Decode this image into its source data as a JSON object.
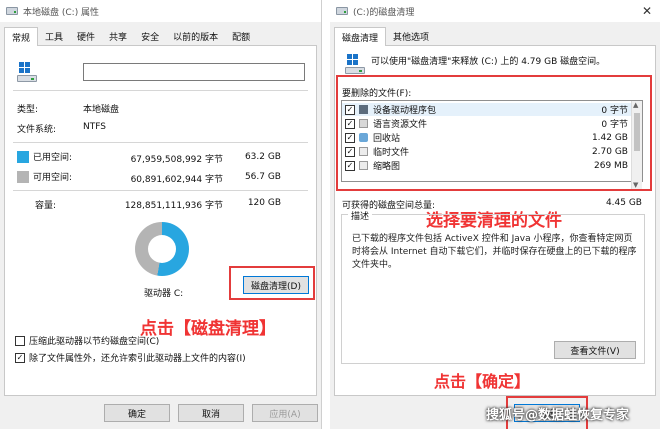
{
  "left": {
    "title": "本地磁盘 (C:) 属性",
    "close_glyph": "✕",
    "tabs": [
      "常规",
      "工具",
      "硬件",
      "共享",
      "安全",
      "以前的版本",
      "配额"
    ],
    "type_label": "类型:",
    "type_value": "本地磁盘",
    "fs_label": "文件系统:",
    "fs_value": "NTFS",
    "used_label": "已用空间:",
    "used_bytes": "67,959,508,992 字节",
    "used_gb": "63.2 GB",
    "free_label": "可用空间:",
    "free_bytes": "60,891,602,944 字节",
    "free_gb": "56.7 GB",
    "cap_label": "容量:",
    "cap_bytes": "128,851,111,936 字节",
    "cap_gb": "120 GB",
    "used_fraction": 0.527,
    "drive_label": "驱动器 C:",
    "cleanup_btn": "磁盘清理(D)",
    "compress_label": "压缩此驱动器以节约磁盘空间(C)",
    "compress_checked": false,
    "index_label": "除了文件属性外，还允许索引此驱动器上文件的内容(I)",
    "index_checked": true,
    "ok_btn": "确定",
    "cancel_btn": "取消",
    "apply_btn": "应用(A)",
    "annotation": "点击【磁盘清理】"
  },
  "right": {
    "title": "(C:)的磁盘清理",
    "close_glyph": "✕",
    "tabs": [
      "磁盘清理",
      "其他选项"
    ],
    "intro": "可以使用\"磁盘清理\"来释放 (C:) 上的 4.79 GB 磁盘空间。",
    "files_label": "要删除的文件(F):",
    "files": [
      {
        "name": "设备驱动程序包",
        "size": "0 字节",
        "checked": true
      },
      {
        "name": "语言资源文件",
        "size": "0 字节",
        "checked": true
      },
      {
        "name": "回收站",
        "size": "1.42 GB",
        "checked": true
      },
      {
        "name": "临时文件",
        "size": "2.70 GB",
        "checked": true
      },
      {
        "name": "缩略图",
        "size": "269 MB",
        "checked": true
      }
    ],
    "obtainable_label": "可获得的磁盘空间总量:",
    "obtainable_value": "4.45 GB",
    "desc_legend": "描述",
    "desc_text": "已下载的程序文件包括 ActiveX 控件和 Java 小程序，你查看特定网页时将会从 Internet 自动下载它们，并临时保存在硬盘上的已下载的程序文件夹中。",
    "view_files_btn": "查看文件(V)",
    "ok_btn": "确定",
    "annotation_select": "选择要清理的文件",
    "annotation_ok": "点击【确定】"
  },
  "watermark": "搜狐号@数据蛙恢复专家",
  "colors": {
    "used": "#28a6e0",
    "free": "#b4b4b4",
    "accent": "#0078d7",
    "annotation": "#f03434"
  }
}
